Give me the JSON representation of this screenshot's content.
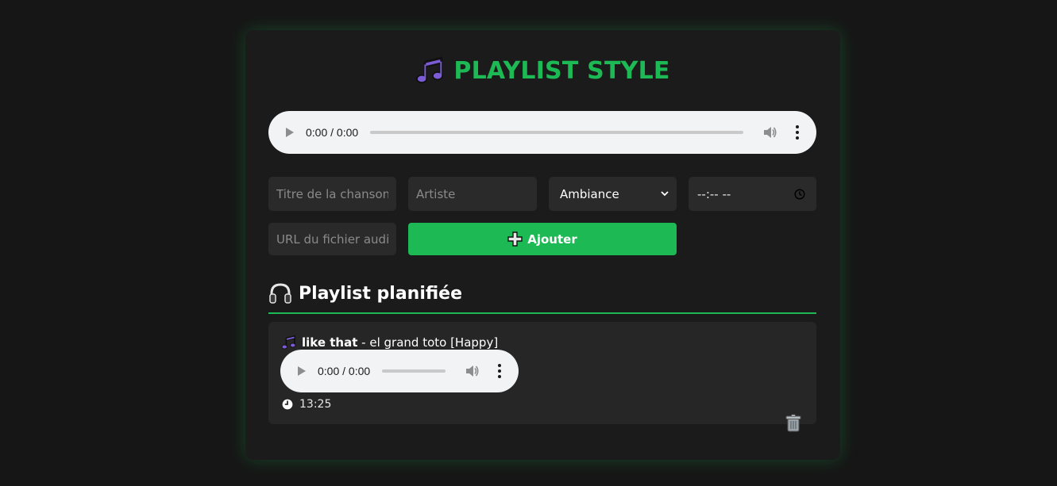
{
  "header": {
    "title": "PLAYLIST STYLE",
    "icon": "music-notes-icon"
  },
  "main_player": {
    "time": "0:00 / 0:00"
  },
  "form": {
    "title_placeholder": "Titre de la chanson",
    "artist_placeholder": "Artiste",
    "mood_selected": "Ambiance",
    "time_value": "--:-- --",
    "url_placeholder": "URL du fichier audio",
    "add_label": "Ajouter",
    "add_icon": "plus-icon"
  },
  "playlist": {
    "heading": "Playlist planifiée",
    "heading_icon": "headphones-icon",
    "items": [
      {
        "title": "like that",
        "rest": " - el grand toto [Happy]",
        "player_time": "0:00 / 0:00",
        "scheduled_time": "13:25",
        "icon": "music-notes-icon",
        "time_icon": "clock-icon",
        "delete_icon": "trash-icon"
      }
    ]
  },
  "colors": {
    "accent": "#1db954",
    "background": "#161616",
    "card": "#1b1b1b",
    "field": "#2a2a2a",
    "note_purple": "#7b5cd6"
  }
}
